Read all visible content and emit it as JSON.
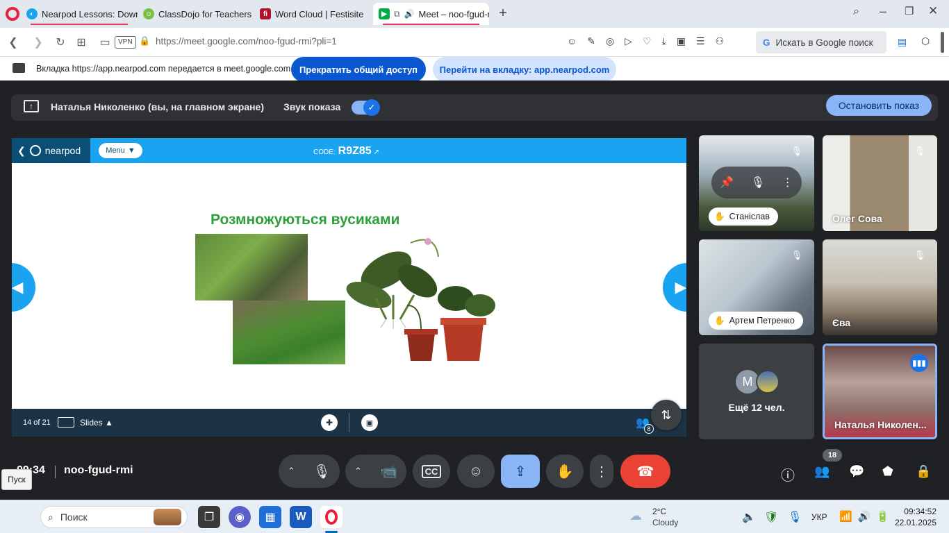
{
  "browser": {
    "tabs": [
      {
        "title": "Nearpod Lessons: Downlo",
        "icon": "nearpod-icon"
      },
      {
        "title": "ClassDojo for Teachers",
        "icon": "classdojo-icon"
      },
      {
        "title": "Word Cloud | Festisite",
        "icon": "festisite-icon"
      },
      {
        "title": "Meet – noo-fgud-rmi",
        "icon": "meet-icon"
      }
    ],
    "vpn_label": "VPN",
    "url": "https://meet.google.com/noo-fgud-rmi?pli=1",
    "search_placeholder": "Искать в Google поиск"
  },
  "share_bar": {
    "message": "Вкладка https://app.nearpod.com передается в meet.google.com",
    "stop_label": "Прекратить общий доступ",
    "switch_label": "Перейти на вкладку: app.nearpod.com"
  },
  "presentation": {
    "presenter": "Наталья Николенко (вы, на главном экране)",
    "audio_label": "Звук показа",
    "stop_show_label": "Остановить показ"
  },
  "nearpod": {
    "logo_text": "nearpod",
    "menu_label": "Menu",
    "code_label": "CODE:",
    "code_value": "R9Z85",
    "slide_title": "Розмножуються вусиками",
    "slide_counter": "14 of 21",
    "slides_label": "Slides",
    "participants_count": "8"
  },
  "participants": [
    {
      "name": "Станіслав",
      "muted": true
    },
    {
      "name": "Олег Сова",
      "muted": true
    },
    {
      "name": "Артем Петренко",
      "muted": true
    },
    {
      "name": "Єва",
      "muted": true
    },
    {
      "name": "Ещё 12 чел.",
      "avatar_letter": "M"
    },
    {
      "name": "Наталья Николен...",
      "speaking": true
    }
  ],
  "meeting": {
    "time": "09:34",
    "code": "noo-fgud-rmi",
    "people_count": "18",
    "tooltip": "Пуск"
  },
  "taskbar": {
    "search_placeholder": "Поиск",
    "weather_temp": "2°C",
    "weather_desc": "Cloudy",
    "language": "УКР",
    "clock_time": "09:34:52",
    "clock_date": "22.01.2025"
  },
  "colors": {
    "meet_bg": "#202124",
    "accent_blue": "#8ab4f8",
    "end_call_red": "#ea4335",
    "nearpod_blue": "#1aa3f0"
  }
}
